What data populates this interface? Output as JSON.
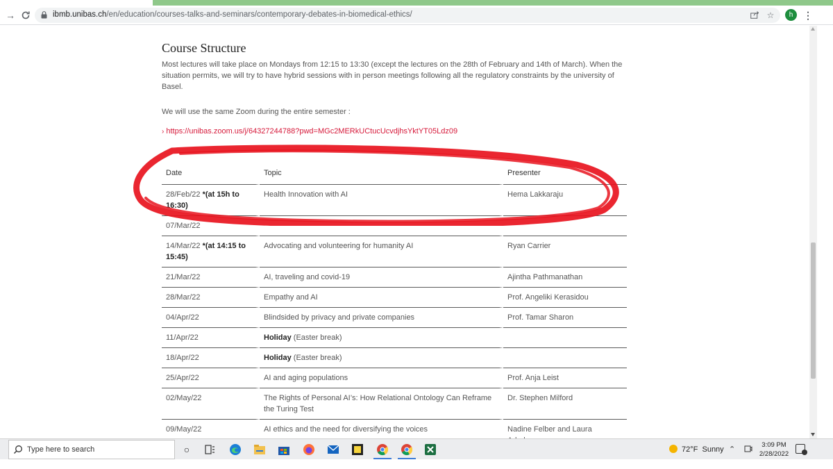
{
  "browser": {
    "url_host": "ibmb.unibas.ch",
    "url_path": "/en/education/courses-talks-and-seminars/contemporary-debates-in-biomedical-ethics/",
    "profile_initial": "h"
  },
  "page": {
    "heading": "Course Structure",
    "paragraph": "Most lectures will take place on Mondays from 12:15 to 13:30 (except the lectures on the 28th of February and 14th of March). When the situation permits, we will try to have hybrid sessions with in person meetings following all the regulatory constraints by the university of Basel.",
    "zoom_intro": "We will use the same Zoom during the entire semester :",
    "zoom_link": "https://unibas.zoom.us/j/64327244788?pwd=MGc2MERkUCtucUcvdjhsYktYT05Ldz09"
  },
  "table": {
    "headers": [
      "Date",
      "Topic",
      "Presenter"
    ],
    "rows": [
      {
        "date": "28/Feb/22",
        "note": "*(at 15h to 16:30)",
        "topic": "Health Innovation with AI",
        "presenter": "Hema Lakkaraju"
      },
      {
        "date": "07/Mar/22",
        "note": "",
        "topic": "",
        "presenter": ""
      },
      {
        "date": "14/Mar/22",
        "note": "*(at 14:15 to 15:45)",
        "topic": "Advocating and volunteering for humanity AI",
        "presenter": "Ryan Carrier"
      },
      {
        "date": "21/Mar/22",
        "note": "",
        "topic": "AI, traveling and covid-19",
        "presenter": "Ajintha Pathmanathan"
      },
      {
        "date": "28/Mar/22",
        "note": "",
        "topic": "Empathy and AI",
        "presenter": "Prof. Angeliki Kerasidou"
      },
      {
        "date": "04/Apr/22",
        "note": "",
        "topic": "Blindsided by privacy and private companies",
        "presenter": "Prof. Tamar Sharon"
      },
      {
        "date": "11/Apr/22",
        "note": "",
        "topic_bold": "Holiday",
        "topic": " (Easter break)",
        "presenter": ""
      },
      {
        "date": "18/Apr/22",
        "note": "",
        "topic_bold": "Holiday",
        "topic": " (Easter break)",
        "presenter": ""
      },
      {
        "date": "25/Apr/22",
        "note": "",
        "topic": "AI and aging populations",
        "presenter": "Prof. Anja Leist"
      },
      {
        "date": "02/May/22",
        "note": "",
        "topic": "The Rights of Personal AI’s: How Relational Ontology Can Reframe the Turing Test",
        "presenter": "Dr. Stephen Milford"
      },
      {
        "date": "09/May/22",
        "note": "",
        "topic": "AI ethics and the need for diversifying the voices",
        "presenter": "Nadine Felber and Laura Arbelaez"
      }
    ]
  },
  "taskbar": {
    "search_placeholder": "Type here to search",
    "weather_temp": "72°F",
    "weather_text": "Sunny",
    "time": "3:09 PM",
    "date": "2/28/2022"
  },
  "colors": {
    "link": "#d6193a",
    "annotation": "#e8141e",
    "tab_strip": "#8fc88a"
  }
}
